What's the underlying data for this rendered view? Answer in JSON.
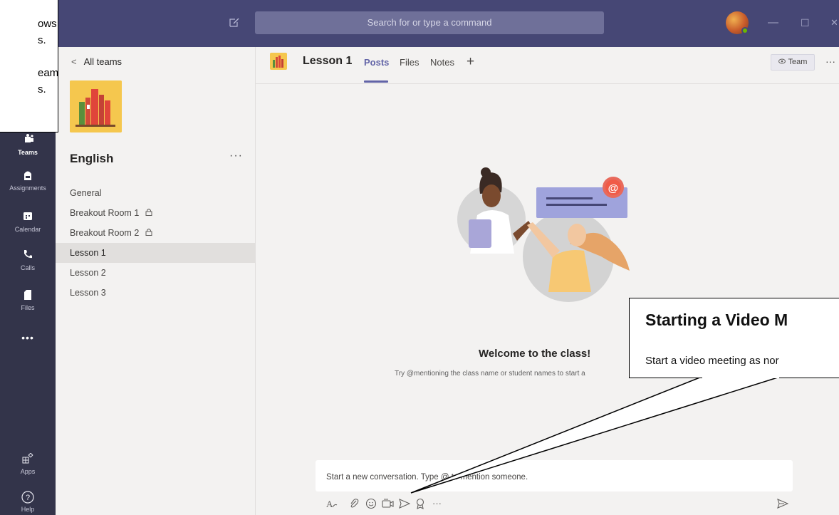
{
  "titlebar": {
    "search_placeholder": "Search for or type a command",
    "compose_icon": "new-chat-icon",
    "minimize": "—",
    "maximize": "☐",
    "close": "✕"
  },
  "rail": {
    "items": [
      {
        "label": "Teams",
        "icon": "teams-icon"
      },
      {
        "label": "Assignments",
        "icon": "assignments-icon"
      },
      {
        "label": "Calendar",
        "icon": "calendar-icon"
      },
      {
        "label": "Calls",
        "icon": "calls-icon"
      },
      {
        "label": "Files",
        "icon": "files-icon"
      },
      {
        "label": "",
        "icon": "more-apps-icon"
      }
    ],
    "bottom_items": [
      {
        "label": "Apps",
        "icon": "apps-icon"
      },
      {
        "label": "Help",
        "icon": "help-icon"
      }
    ],
    "more_glyph": "•••"
  },
  "panel": {
    "back_label": "All teams",
    "back_glyph": "<",
    "team_name": "English",
    "team_more": "···",
    "channels": [
      {
        "name": "General",
        "locked": false
      },
      {
        "name": "Breakout Room 1",
        "locked": true
      },
      {
        "name": "Breakout Room 2",
        "locked": true
      },
      {
        "name": "Lesson 1",
        "locked": false,
        "selected": true
      },
      {
        "name": "Lesson 2",
        "locked": false
      },
      {
        "name": "Lesson 3",
        "locked": false
      }
    ]
  },
  "header": {
    "channel_title": "Lesson 1",
    "tabs": [
      "Posts",
      "Files",
      "Notes"
    ],
    "add_tab_glyph": "+",
    "team_button": "Team",
    "more_glyph": "···"
  },
  "welcome": {
    "title": "Welcome to the class!",
    "subtitle": "Try @mentioning the class name or student names to start a"
  },
  "compose": {
    "placeholder": "Start a new conversation. Type @ to mention someone.",
    "tools": [
      "format-icon",
      "attach-icon",
      "emoji-icon",
      "meet-now-icon",
      "send-later-icon",
      "praise-icon",
      "more-options-icon",
      "send-icon"
    ]
  },
  "annotations": {
    "left_lines": [
      "ows",
      "s.",
      "",
      "eam",
      "s."
    ],
    "right_title": "Starting a Video M",
    "right_body": "Start a video meeting as nor"
  },
  "colors": {
    "titlebar": "#464775",
    "rail": "#33344a",
    "accent": "#6264a7",
    "background": "#f3f2f1"
  }
}
